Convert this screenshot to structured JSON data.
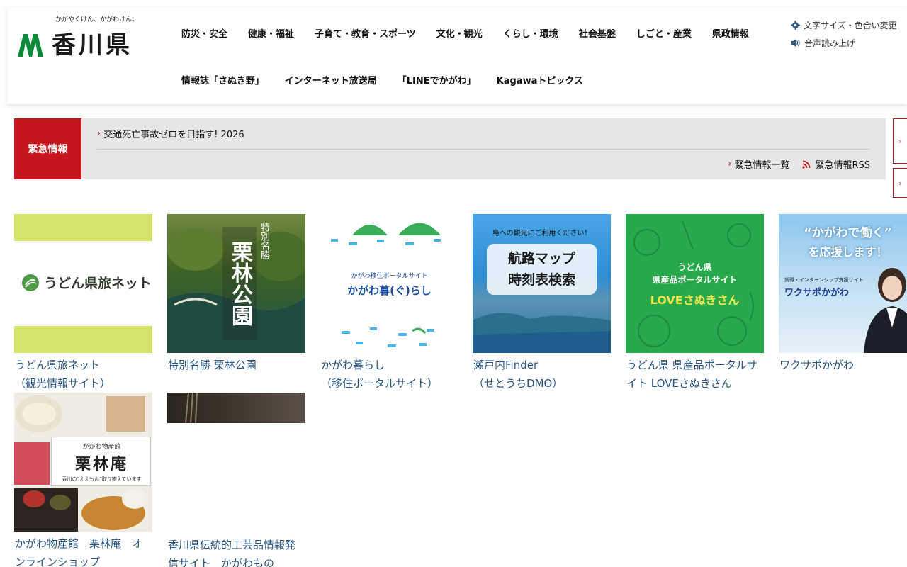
{
  "header": {
    "logo_tagline": "かがやくけん、かがわけん。",
    "logo_text": "香川県",
    "nav_row1": [
      "防災・安全",
      "健康・福祉",
      "子育て・教育・スポーツ",
      "文化・観光",
      "くらし・環境",
      "社会基盤",
      "しごと・産業",
      "県政情報"
    ],
    "nav_row2": [
      "情報誌「さぬき野」",
      "インターネット放送局",
      "「LINEでかがわ」",
      "Kagawaトピックス"
    ],
    "util": {
      "font_color": "文字サイズ・色合い変更",
      "read_aloud": "音声読み上げ"
    }
  },
  "emergency": {
    "label": "緊急情報",
    "news": [
      "交通死亡事故ゼロを目指す! 2026"
    ],
    "list_link": "緊急情報一覧",
    "rss_link": "緊急情報RSS"
  },
  "banners": [
    {
      "caption_1": "うどん県旅ネット",
      "caption_2": "（観光情報サイト）",
      "img_text": "うどん県旅ネット"
    },
    {
      "caption_1": "特別名勝 栗林公園",
      "caption_2": "",
      "img_title": "栗林公園",
      "img_sub": "特別名勝"
    },
    {
      "caption_1": "かがわ暮らし",
      "caption_2": "（移住ポータルサイト）",
      "img_title": "かがわ暮(ぐ)らし",
      "img_sub": "かがわ移住ポータルサイト"
    },
    {
      "caption_1": "瀬戸内Finder",
      "caption_2": "（せとうちDMO）",
      "img_top": "島への観光にご利用ください！",
      "img_box_1": "航路マップ",
      "img_box_2": "時刻表検索"
    },
    {
      "caption_1": "うどん県 県産品ポータルサ",
      "caption_2": "イト LOVEさぬきさん",
      "img_t1": "うどん県",
      "img_t2": "県産品ポータルサイト",
      "img_t3": "LOVEさぬきさん"
    },
    {
      "caption_1": "ワクサポかがわ",
      "caption_2": "",
      "img_t1": "“かがわで働く”",
      "img_t2": "を応援します！",
      "img_t3": "就職・インターンシップ支援サイト",
      "img_t4": "ワクサポかがわ"
    },
    {
      "caption_1": "かがわ物産館　栗林庵　オ",
      "caption_2": "ンラインショップ",
      "img_t1": "かがわ物産館",
      "img_t2": "栗林庵",
      "img_t3": "香川の“ええもん”取り揃えています"
    },
    {
      "caption_1": "香川県伝統的工芸品情報発",
      "caption_2": "信サイト　かがわもの"
    }
  ],
  "colors": {
    "emergency_red": "#c6151c",
    "link_blue": "#2a5684",
    "logo_green": "#0b8a3a"
  }
}
